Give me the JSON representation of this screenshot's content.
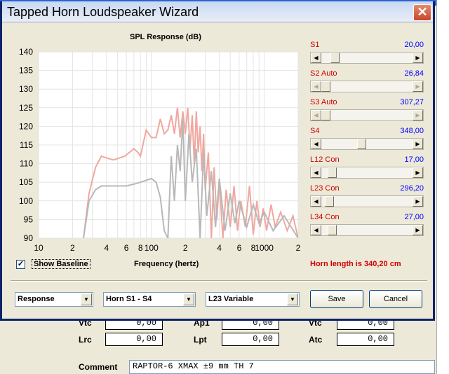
{
  "window": {
    "title": "Tapped Horn Loudspeaker Wizard",
    "close_glyph": "✕"
  },
  "chart_data": {
    "type": "line",
    "title": "SPL Response (dB)",
    "xlabel": "Frequency (hertz)",
    "ylabel": "",
    "x_scale": "log",
    "xlim": [
      10,
      2000
    ],
    "ylim": [
      90,
      140
    ],
    "x_tick_labels": [
      {
        "f": 10,
        "label": "10"
      },
      {
        "f": 20,
        "label": "2"
      },
      {
        "f": 40,
        "label": "4"
      },
      {
        "f": 60,
        "label": "6"
      },
      {
        "f": 80,
        "label": "8"
      },
      {
        "f": 100,
        "label": "100"
      },
      {
        "f": 200,
        "label": "2"
      },
      {
        "f": 400,
        "label": "4"
      },
      {
        "f": 600,
        "label": "6"
      },
      {
        "f": 800,
        "label": "8"
      },
      {
        "f": 1000,
        "label": "1000"
      },
      {
        "f": 2000,
        "label": "2"
      }
    ],
    "y_ticks": [
      90,
      95,
      100,
      105,
      110,
      115,
      120,
      125,
      130,
      135,
      140
    ],
    "grid": true,
    "series": [
      {
        "color": "#f0a8a0",
        "x": [
          25,
          28,
          32,
          36,
          40,
          46,
          52,
          58,
          64,
          70,
          76,
          80,
          90,
          100,
          110,
          120,
          130,
          140,
          150,
          160,
          170,
          180,
          190,
          200,
          210,
          220,
          230,
          240,
          250,
          260,
          270,
          280,
          290,
          300,
          320,
          340,
          360,
          380,
          400,
          430,
          460,
          500,
          540,
          580,
          620,
          680,
          740,
          800,
          860,
          920,
          980,
          1050,
          1150,
          1250,
          1400,
          1600,
          1800,
          2000
        ],
        "y": [
          90,
          102,
          109,
          112,
          111.5,
          111,
          111.5,
          112,
          113,
          114,
          113,
          112,
          119,
          117,
          117,
          122,
          118,
          119,
          123,
          118,
          125,
          117,
          124,
          118,
          125,
          114,
          123,
          110,
          124,
          113,
          120,
          108,
          118,
          103,
          113,
          90,
          109,
          95,
          105,
          90,
          103,
          93,
          104,
          92,
          100,
          93,
          104,
          91,
          100,
          93,
          98,
          92,
          99,
          93,
          97,
          92,
          96,
          90
        ]
      },
      {
        "color": "#b8b8b8",
        "x": [
          25,
          28,
          32,
          36,
          40,
          50,
          60,
          70,
          80,
          90,
          100,
          110,
          120,
          130,
          140,
          150,
          160,
          170,
          180,
          190,
          200,
          215,
          230,
          250,
          270,
          290,
          310,
          340,
          370,
          400,
          450,
          500,
          550,
          600,
          700,
          800,
          900,
          1000,
          1200,
          1500,
          2000
        ],
        "y": [
          90,
          100,
          103,
          104,
          104,
          104,
          104,
          104.5,
          105,
          105.5,
          106,
          105,
          101,
          92,
          90,
          112,
          100,
          115,
          108,
          122,
          100,
          118,
          105,
          114,
          90,
          113,
          96,
          108,
          93,
          106,
          92,
          102,
          94,
          100,
          93,
          99,
          94,
          97,
          92,
          96,
          90
        ]
      }
    ]
  },
  "baseline": {
    "checked": true,
    "check_glyph": "✓",
    "label": "Show Baseline"
  },
  "sliders": [
    {
      "label": "S1",
      "value": "20,00",
      "position": 0.11,
      "left_arrow": "◀",
      "right_arrow": "▶"
    },
    {
      "label": "S2 Auto",
      "value": "26,84",
      "position": 0.0,
      "left_arrow": "◀",
      "right_arrow": "▶",
      "disabled": true
    },
    {
      "label": "S3 Auto",
      "value": "307,27",
      "position": 0.0,
      "left_arrow": "◀",
      "right_arrow": "▶",
      "disabled": true
    },
    {
      "label": "S4",
      "value": "348,00",
      "position": 0.44,
      "left_arrow": "◀",
      "right_arrow": "▶"
    },
    {
      "label": "L12 Con",
      "value": "17,00",
      "position": 0.08,
      "left_arrow": "◀",
      "right_arrow": "▶"
    },
    {
      "label": "L23 Con",
      "value": "296,20",
      "position": 0.04,
      "left_arrow": "◀",
      "right_arrow": "▶"
    },
    {
      "label": "L34 Con",
      "value": "27,00",
      "position": 0.08,
      "left_arrow": "◀",
      "right_arrow": "▶"
    }
  ],
  "horn_length": "Horn length is 340,20 cm",
  "combos": [
    {
      "value": "Response",
      "arrow": "▼"
    },
    {
      "value": "Horn S1 - S4",
      "arrow": "▼"
    },
    {
      "value": "L23 Variable",
      "arrow": "▼"
    }
  ],
  "buttons": {
    "save": "Save",
    "cancel": "Cancel"
  },
  "background": {
    "fields": [
      {
        "label": "Vtc",
        "value": "0,00"
      },
      {
        "label": "Ap1",
        "value": "0,00"
      },
      {
        "label": "Vtc",
        "value": "0,00"
      },
      {
        "label": "Lrc",
        "value": "0,00"
      },
      {
        "label": "Lpt",
        "value": "0,00"
      },
      {
        "label": "Atc",
        "value": "0,00"
      }
    ],
    "comment_label": "Comment",
    "comment_value": "RAPTOR-6  XMAX ±9 mm  TH 7"
  }
}
